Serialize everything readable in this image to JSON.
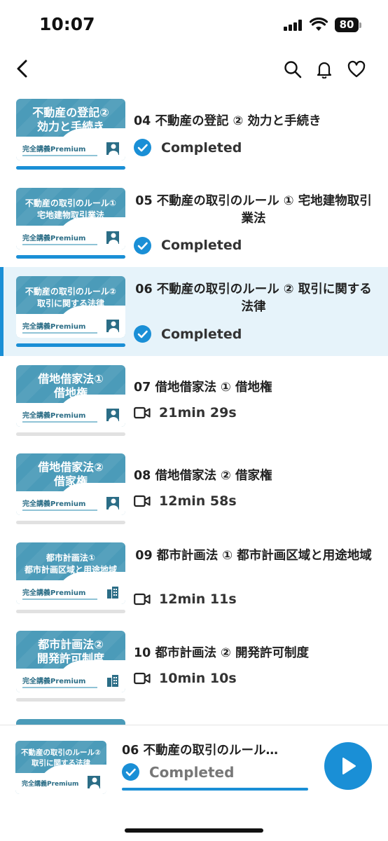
{
  "status_bar": {
    "time": "10:07",
    "battery": "80"
  },
  "colors": {
    "accent": "#1a8fd6",
    "thumbnail": "#4b9bb9",
    "active_row": "#e6f3fa"
  },
  "nav": {
    "icons": [
      "back-icon",
      "search-icon",
      "bell-icon",
      "heart-icon"
    ]
  },
  "lectures": [
    {
      "thumb_title": "不動産の登記②\n効力と手続き",
      "thumb_brand": "完全講義Premium",
      "title": "04 不動産の登記 ② 効力と手続き",
      "status": "Completed",
      "progress": 1.0,
      "active": false
    },
    {
      "thumb_title": "不動産の取引のルール①\n宅地建物取引業法",
      "thumb_brand": "完全講義Premium",
      "title": "05 不動産の取引のルール ① 宅地建物取引業法",
      "status": "Completed",
      "progress": 1.0,
      "active": false
    },
    {
      "thumb_title": "不動産の取引のルール②\n取引に関する法律",
      "thumb_brand": "完全講義Premium",
      "title": "06 不動産の取引のルール ② 取引に関する法律",
      "status": "Completed",
      "progress": 1.0,
      "active": true
    },
    {
      "thumb_title": "借地借家法①\n借地権",
      "thumb_brand": "完全講義Premium",
      "title": "07 借地借家法 ① 借地権",
      "duration": "21min 29s",
      "progress": 0.0,
      "active": false
    },
    {
      "thumb_title": "借地借家法②\n借家権",
      "thumb_brand": "完全講義Premium",
      "title": "08 借地借家法 ② 借家権",
      "duration": "12min 58s",
      "progress": 0.0,
      "active": false
    },
    {
      "thumb_title": "都市計画法①\n都市計画区域と用途地域",
      "thumb_brand": "完全講義Premium",
      "title": "09 都市計画法 ① 都市計画区域と用途地域",
      "duration": "12min 11s",
      "progress": 0.0,
      "active": false
    },
    {
      "thumb_title": "都市計画法②\n開発許可制度",
      "thumb_brand": "完全講義Premium",
      "title": "10 都市計画法 ② 開発許可制度",
      "duration": "10min 10s",
      "progress": 0.0,
      "active": false
    }
  ],
  "player": {
    "thumb_title": "不動産の取引のルール②\n取引に関する法律",
    "thumb_brand": "完全講義Premium",
    "title": "06 不動産の取引のルール…",
    "status": "Completed",
    "progress": 1.0
  }
}
